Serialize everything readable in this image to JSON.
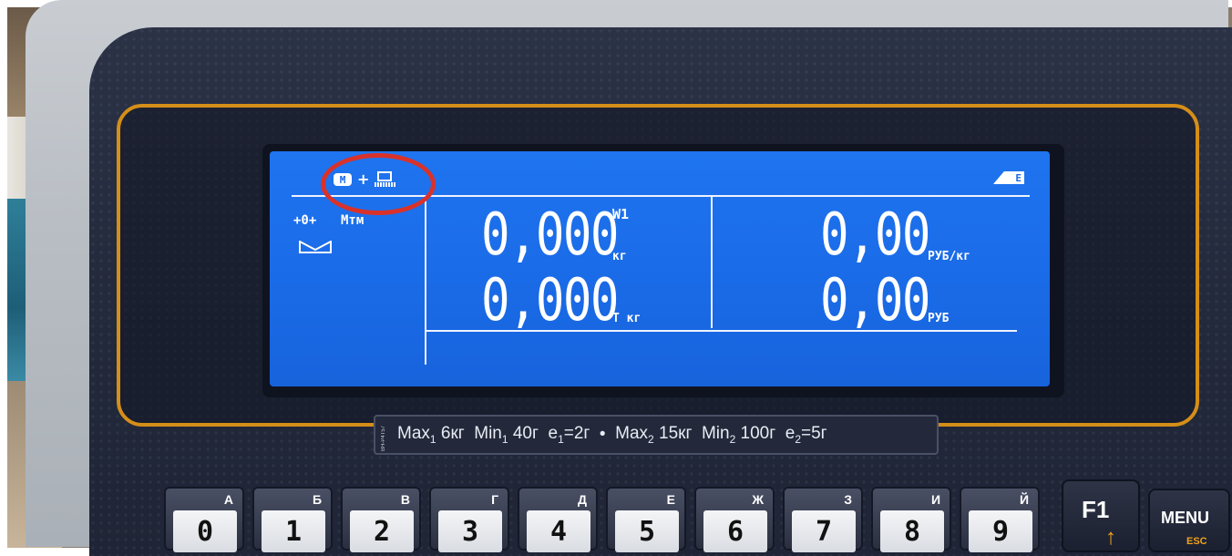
{
  "display": {
    "status": {
      "m_icon": "M",
      "zero_indicator": "+0+",
      "mode_text": "Мтм",
      "battery_label": "E",
      "icons": [
        "m-icon",
        "arrow-right-icon",
        "pc-connection-icon",
        "battery-icon",
        "envelope-icon"
      ]
    },
    "weight": {
      "value": "0,000",
      "channel": "W1",
      "unit": "кг"
    },
    "tare": {
      "value": "0,000",
      "unit": "Т кг"
    },
    "price": {
      "value": "0,00",
      "unit": "РУБ/кг"
    },
    "total": {
      "value": "0,00",
      "unit": "РУБ"
    }
  },
  "spec_plate": {
    "max1": "6кг",
    "min1": "40г",
    "e1": "=2г",
    "max2": "15кг",
    "min2": "100г",
    "e2": "=5г",
    "serial": "ВН-Р4Т57"
  },
  "keypad": {
    "keys": [
      {
        "letter": "А",
        "digit": "0"
      },
      {
        "letter": "Б",
        "digit": "1"
      },
      {
        "letter": "В",
        "digit": "2"
      },
      {
        "letter": "Г",
        "digit": "3"
      },
      {
        "letter": "Д",
        "digit": "4"
      },
      {
        "letter": "Е",
        "digit": "5"
      },
      {
        "letter": "Ж",
        "digit": "6"
      },
      {
        "letter": "З",
        "digit": "7"
      },
      {
        "letter": "И",
        "digit": "8"
      },
      {
        "letter": "Й",
        "digit": "9"
      }
    ],
    "f1_label": "F1",
    "menu_label": "MENU",
    "menu_sub": "ESC"
  },
  "colors": {
    "lcd": "#1a6ae6",
    "frame": "#d58e18",
    "highlight_ring": "#d9322a",
    "panel": "#232a3c"
  }
}
